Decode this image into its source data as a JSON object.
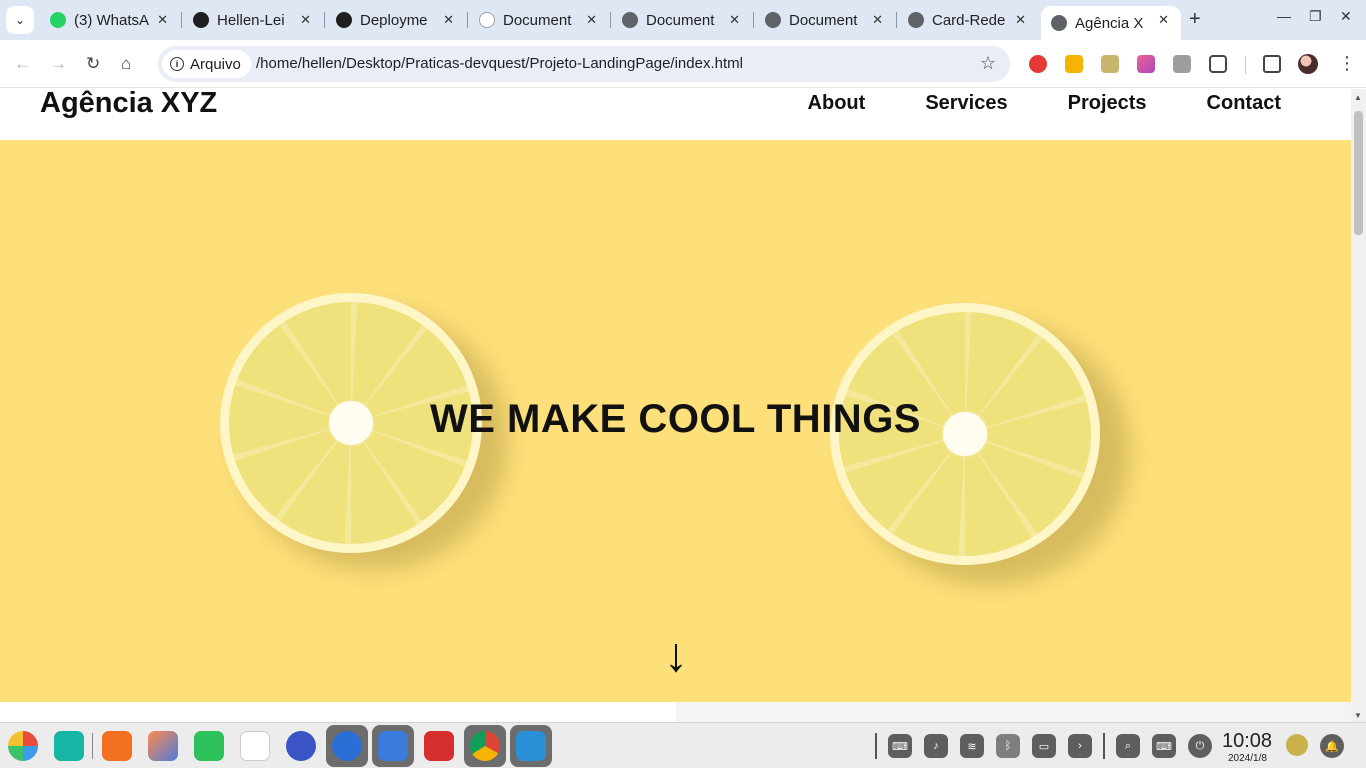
{
  "browser": {
    "tabs": [
      {
        "title": "(3) WhatsA",
        "icon": "whatsapp-icon",
        "color": "#25d366"
      },
      {
        "title": "Hellen-Lei",
        "icon": "github-icon",
        "color": "#1f1f1f"
      },
      {
        "title": "Deployme",
        "icon": "github-icon",
        "color": "#1f1f1f"
      },
      {
        "title": "Document",
        "icon": "page-icon",
        "color": "#8a8a8a"
      },
      {
        "title": "Document",
        "icon": "globe-icon",
        "color": "#5f6368"
      },
      {
        "title": "Document",
        "icon": "globe-icon",
        "color": "#5f6368"
      },
      {
        "title": "Card-Rede",
        "icon": "globe-icon",
        "color": "#5f6368"
      },
      {
        "title": "Agência X",
        "icon": "globe-icon",
        "color": "#5f6368",
        "active": true
      }
    ],
    "address": {
      "chip_label": "Arquivo",
      "url": "/home/hellen/Desktop/Praticas-devquest/Projeto-LandingPage/index.html"
    }
  },
  "page": {
    "brand": "Agência XYZ",
    "nav": [
      "About",
      "Services",
      "Projects",
      "Contact"
    ],
    "hero": {
      "title": "WE MAKE COOL THINGS",
      "arrow": "↓",
      "background_color": "#fde07a"
    }
  },
  "taskbar": {
    "clock_time": "10:08",
    "clock_date": "2024/1/8"
  }
}
